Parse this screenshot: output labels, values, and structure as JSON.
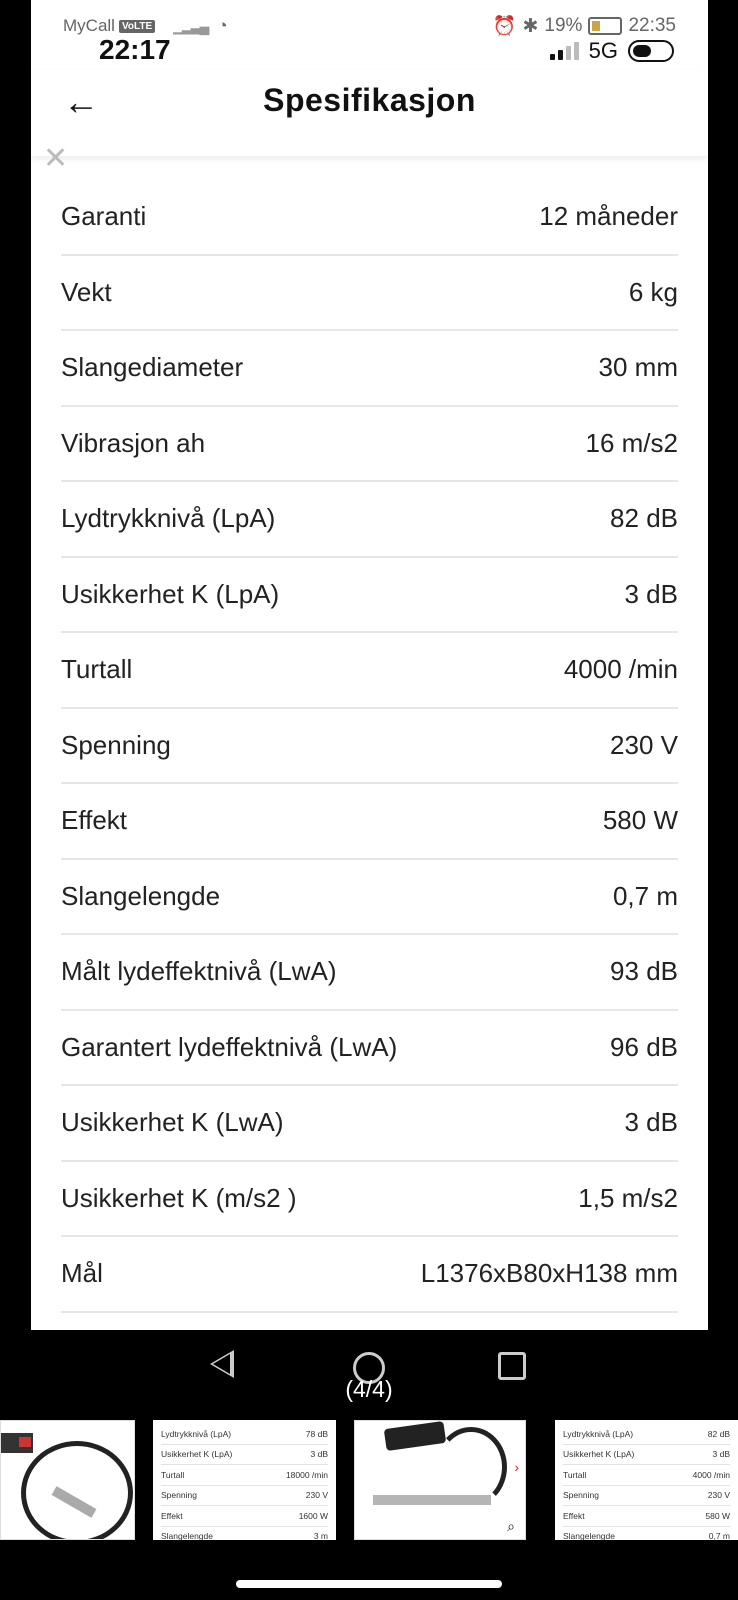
{
  "status_bar": {
    "carrier": "MyCall",
    "volte": "VoLTE",
    "time_small": "22:35",
    "time_big": "22:17",
    "battery_percent": "19%",
    "network": "5G"
  },
  "header": {
    "title": "Spesifikasjon"
  },
  "specs": [
    {
      "label": "Garanti",
      "value": "12 måneder"
    },
    {
      "label": "Vekt",
      "value": "6 kg"
    },
    {
      "label": "Slangediameter",
      "value": "30 mm"
    },
    {
      "label": "Vibrasjon ah",
      "value": "16 m/s2"
    },
    {
      "label": "Lydtrykknivå (LpA)",
      "value": "82 dB"
    },
    {
      "label": "Usikkerhet K (LpA)",
      "value": "3 dB"
    },
    {
      "label": "Turtall",
      "value": "4000 /min"
    },
    {
      "label": "Spenning",
      "value": "230 V"
    },
    {
      "label": "Effekt",
      "value": "580 W"
    },
    {
      "label": "Slangelengde",
      "value": "0,7 m"
    },
    {
      "label": "Målt lydeffektnivå (LwA)",
      "value": "93 dB"
    },
    {
      "label": "Garantert lydeffektnivå (LwA)",
      "value": "96 dB"
    },
    {
      "label": "Usikkerhet K (LwA)",
      "value": "3 dB"
    },
    {
      "label": "Usikkerhet K (m/s2 )",
      "value": "1,5 m/s2"
    },
    {
      "label": "Mål",
      "value": "L1376xB80xH138 mm"
    }
  ],
  "gallery": {
    "counter": "(4/4)",
    "thumb2": [
      {
        "label": "Lydtrykknivå (LpA)",
        "value": "78 dB"
      },
      {
        "label": "Usikkerhet K (LpA)",
        "value": "3 dB"
      },
      {
        "label": "Turtall",
        "value": "18000 /min"
      },
      {
        "label": "Spenning",
        "value": "230 V"
      },
      {
        "label": "Effekt",
        "value": "1600 W"
      },
      {
        "label": "Slangelengde",
        "value": "3 m"
      }
    ],
    "thumb4": [
      {
        "label": "Lydtrykknivå (LpA)",
        "value": "82 dB"
      },
      {
        "label": "Usikkerhet K (LpA)",
        "value": "3 dB"
      },
      {
        "label": "Turtall",
        "value": "4000 /min"
      },
      {
        "label": "Spenning",
        "value": "230 V"
      },
      {
        "label": "Effekt",
        "value": "580 W"
      },
      {
        "label": "Slangelengde",
        "value": "0,7 m"
      }
    ]
  }
}
